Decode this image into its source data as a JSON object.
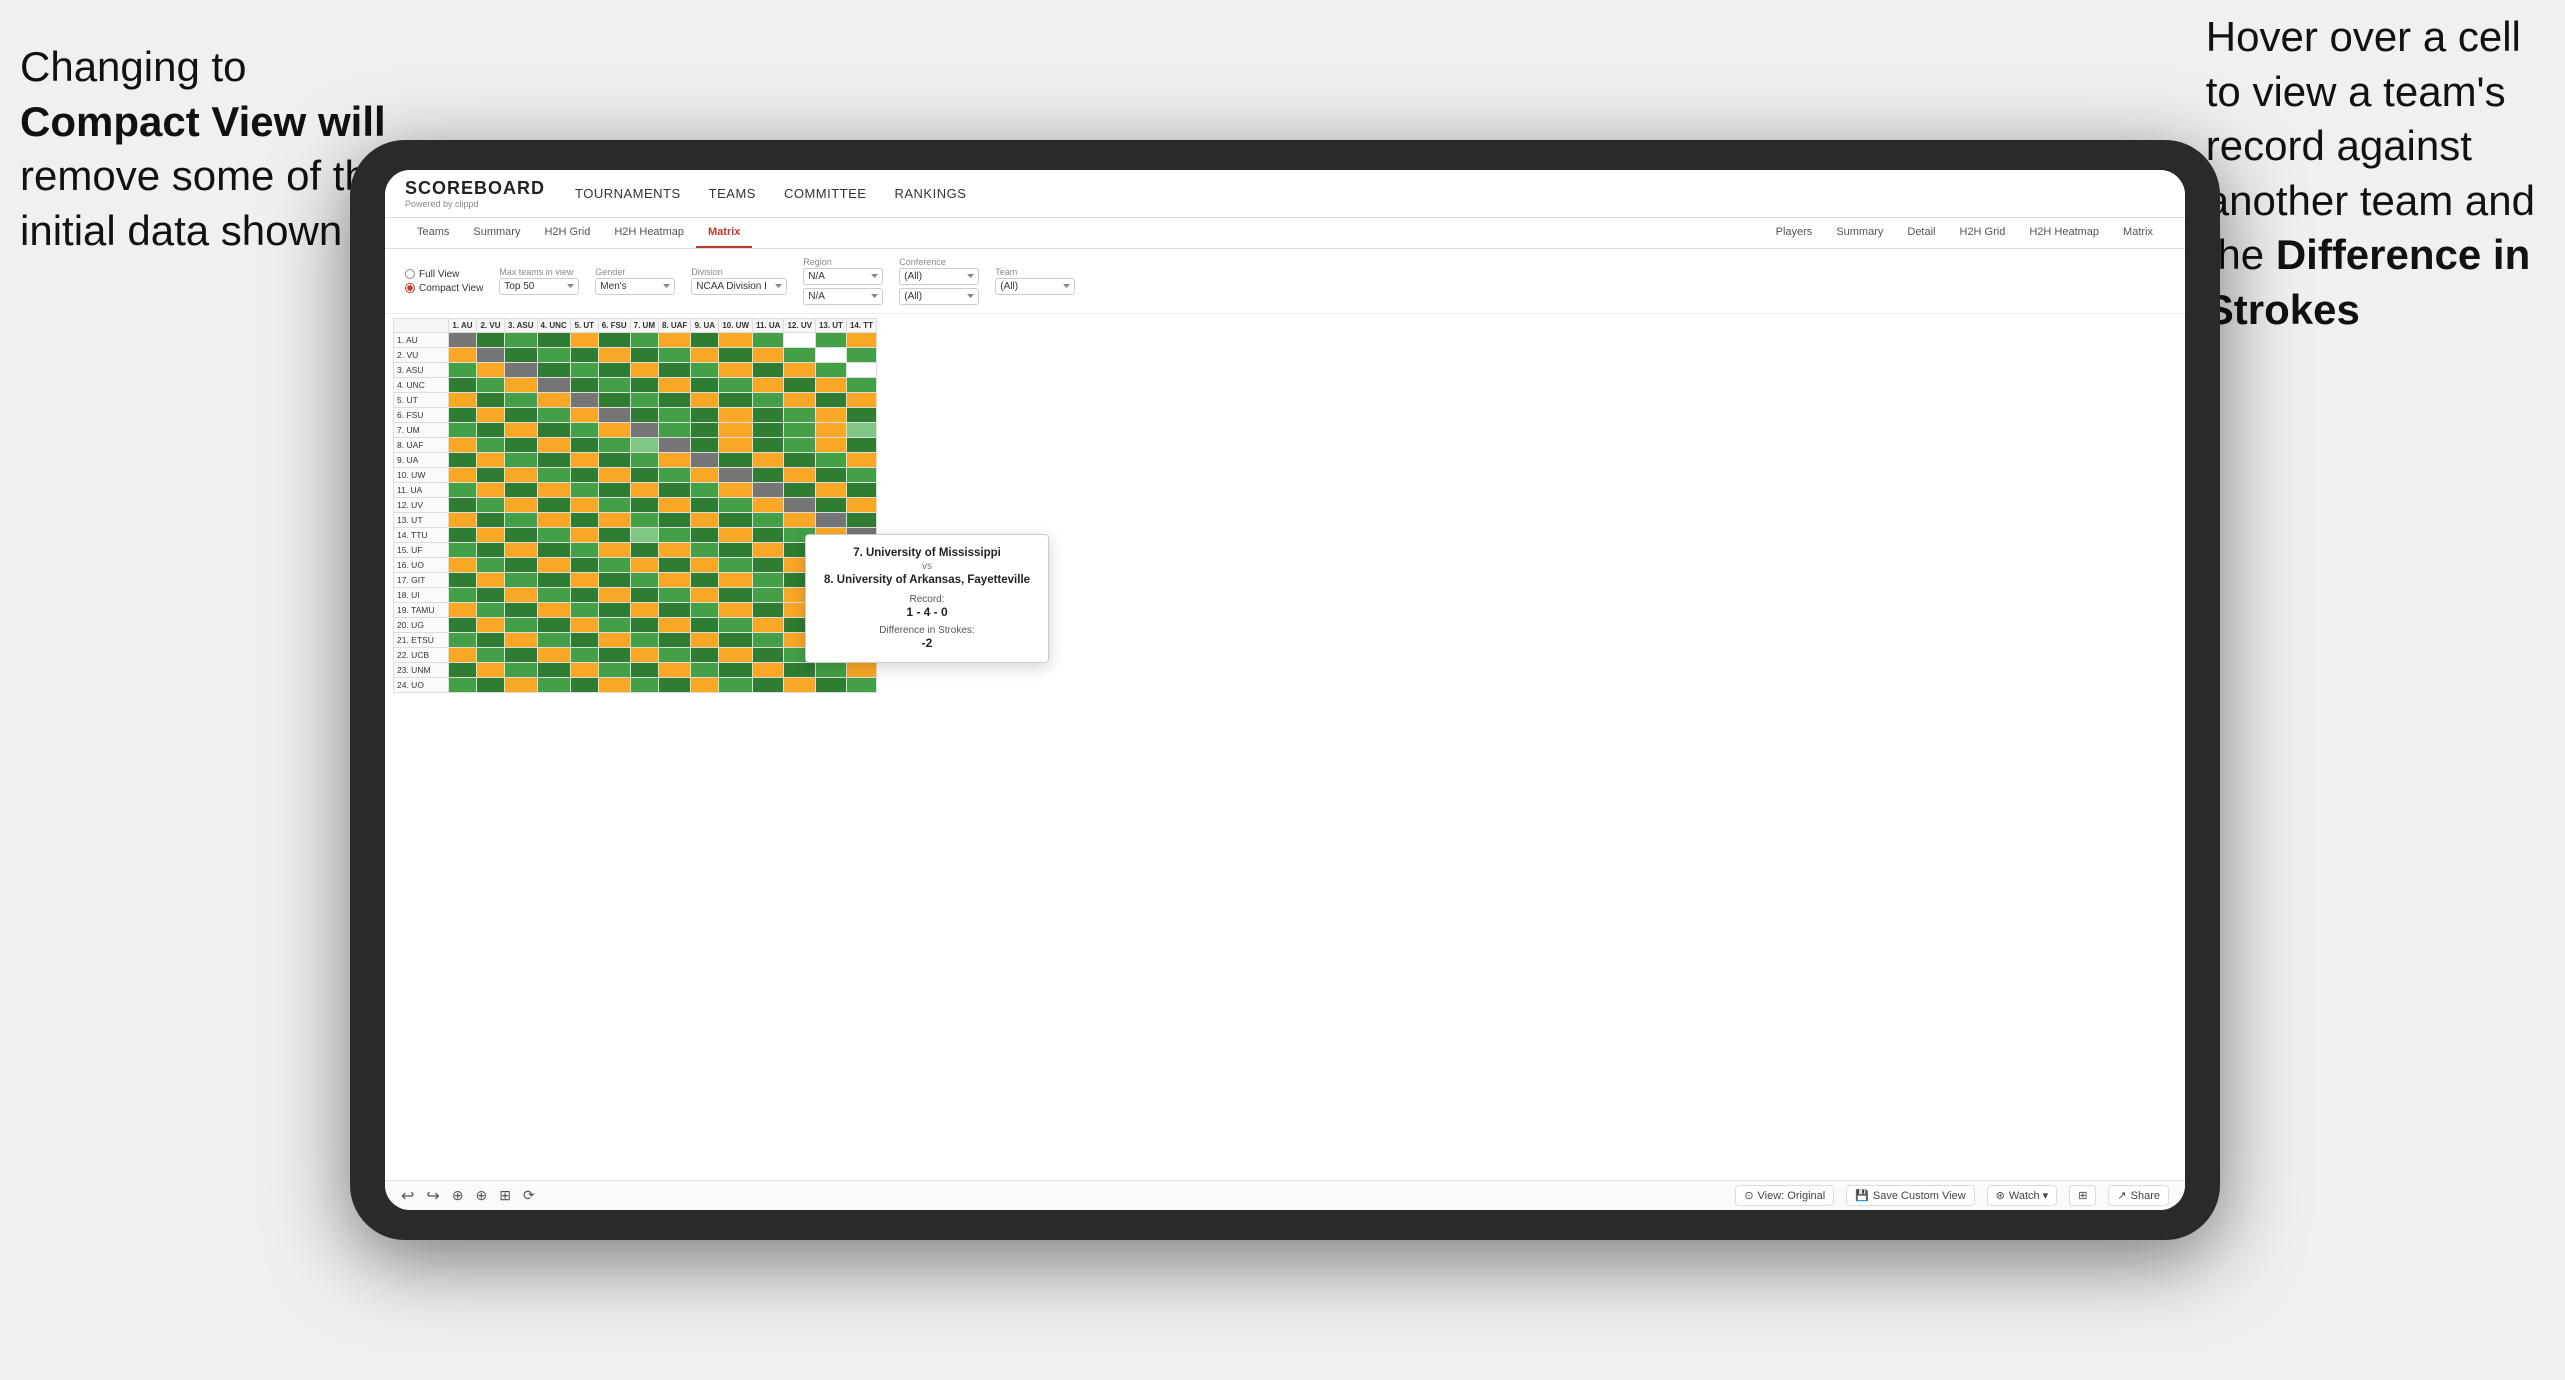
{
  "annotations": {
    "left_text_line1": "Changing to",
    "left_text_line2": "Compact View will",
    "left_text_line3": "remove some of the",
    "left_text_line4": "initial data shown",
    "right_text_line1": "Hover over a cell",
    "right_text_line2": "to view a team's",
    "right_text_line3": "record against",
    "right_text_line4": "another team and",
    "right_text_line5": "the ",
    "right_text_bold": "Difference in",
    "right_text_line6": "Strokes"
  },
  "navbar": {
    "logo": "SCOREBOARD",
    "logo_sub": "Powered by clippd",
    "nav_items": [
      "TOURNAMENTS",
      "TEAMS",
      "COMMITTEE",
      "RANKINGS"
    ]
  },
  "subnav": {
    "left_tabs": [
      "Teams",
      "Summary",
      "H2H Grid",
      "H2H Heatmap",
      "Matrix"
    ],
    "right_tabs": [
      "Players",
      "Summary",
      "Detail",
      "H2H Grid",
      "H2H Heatmap",
      "Matrix"
    ],
    "active": "Matrix"
  },
  "filters": {
    "view_options": [
      "Full View",
      "Compact View"
    ],
    "active_view": "Compact View",
    "max_teams_label": "Max teams in view",
    "max_teams_value": "Top 50",
    "gender_label": "Gender",
    "gender_value": "Men's",
    "division_label": "Division",
    "division_value": "NCAA Division I",
    "region_label": "Region",
    "region_value1": "N/A",
    "region_value2": "N/A",
    "conference_label": "Conference",
    "conference_value1": "(All)",
    "conference_value2": "(All)",
    "team_label": "Team",
    "team_value": "(All)"
  },
  "col_headers": [
    "1. AU",
    "2. VU",
    "3. ASU",
    "4. UNC",
    "5. UT",
    "6. FSU",
    "7. UM",
    "8. UAF",
    "9. UA",
    "10. UW",
    "11. UA",
    "12. UV",
    "13. UT",
    "14. TT"
  ],
  "row_data": [
    {
      "label": "1. AU",
      "cells": [
        "self",
        "g1",
        "g2",
        "g1",
        "y",
        "g1",
        "g2",
        "y",
        "g1",
        "y",
        "g2",
        "w",
        "g2",
        "y"
      ]
    },
    {
      "label": "2. VU",
      "cells": [
        "y",
        "self",
        "g1",
        "g2",
        "g1",
        "y",
        "g1",
        "g2",
        "y",
        "g1",
        "y",
        "g2",
        "w",
        "g2"
      ]
    },
    {
      "label": "3. ASU",
      "cells": [
        "g2",
        "y",
        "self",
        "g1",
        "g2",
        "g1",
        "y",
        "g1",
        "g2",
        "y",
        "g1",
        "y",
        "g2",
        "w"
      ]
    },
    {
      "label": "4. UNC",
      "cells": [
        "g1",
        "g2",
        "y",
        "self",
        "g1",
        "g2",
        "g1",
        "y",
        "g1",
        "g2",
        "y",
        "g1",
        "y",
        "g2"
      ]
    },
    {
      "label": "5. UT",
      "cells": [
        "y",
        "g1",
        "g2",
        "y",
        "self",
        "g1",
        "g2",
        "g1",
        "y",
        "g1",
        "g2",
        "y",
        "g1",
        "y"
      ]
    },
    {
      "label": "6. FSU",
      "cells": [
        "g1",
        "y",
        "g1",
        "g2",
        "y",
        "self",
        "g1",
        "g2",
        "g1",
        "y",
        "g1",
        "g2",
        "y",
        "g1"
      ]
    },
    {
      "label": "7. UM",
      "cells": [
        "g2",
        "g1",
        "y",
        "g1",
        "g2",
        "y",
        "self",
        "g2",
        "g1",
        "y",
        "g1",
        "g2",
        "y",
        "gl"
      ]
    },
    {
      "label": "8. UAF",
      "cells": [
        "y",
        "g2",
        "g1",
        "y",
        "g1",
        "g2",
        "gl",
        "self",
        "g1",
        "y",
        "g1",
        "g2",
        "y",
        "g1"
      ]
    },
    {
      "label": "9. UA",
      "cells": [
        "g1",
        "y",
        "g2",
        "g1",
        "y",
        "g1",
        "g2",
        "y",
        "self",
        "g1",
        "y",
        "g1",
        "g2",
        "y"
      ]
    },
    {
      "label": "10. UW",
      "cells": [
        "y",
        "g1",
        "y",
        "g2",
        "g1",
        "y",
        "g1",
        "g2",
        "y",
        "self",
        "g1",
        "y",
        "g1",
        "g2"
      ]
    },
    {
      "label": "11. UA",
      "cells": [
        "g2",
        "y",
        "g1",
        "y",
        "g2",
        "g1",
        "y",
        "g1",
        "g2",
        "y",
        "self",
        "g1",
        "y",
        "g1"
      ]
    },
    {
      "label": "12. UV",
      "cells": [
        "g1",
        "g2",
        "y",
        "g1",
        "y",
        "g2",
        "g1",
        "y",
        "g1",
        "g2",
        "y",
        "self",
        "g1",
        "y"
      ]
    },
    {
      "label": "13. UT",
      "cells": [
        "y",
        "g1",
        "g2",
        "y",
        "g1",
        "y",
        "g2",
        "g1",
        "y",
        "g1",
        "g2",
        "y",
        "self",
        "g1"
      ]
    },
    {
      "label": "14. TTU",
      "cells": [
        "g1",
        "y",
        "g1",
        "g2",
        "y",
        "g1",
        "gl",
        "g2",
        "g1",
        "y",
        "g1",
        "g2",
        "y",
        "self"
      ]
    },
    {
      "label": "15. UF",
      "cells": [
        "g2",
        "g1",
        "y",
        "g1",
        "g2",
        "y",
        "g1",
        "y",
        "g2",
        "g1",
        "y",
        "g1",
        "g2",
        "y"
      ]
    },
    {
      "label": "16. UO",
      "cells": [
        "y",
        "g2",
        "g1",
        "y",
        "g1",
        "g2",
        "y",
        "g1",
        "y",
        "g2",
        "g1",
        "y",
        "g1",
        "g2"
      ]
    },
    {
      "label": "17. GIT",
      "cells": [
        "g1",
        "y",
        "g2",
        "g1",
        "y",
        "g1",
        "g2",
        "y",
        "g1",
        "y",
        "g2",
        "g1",
        "y",
        "g1"
      ]
    },
    {
      "label": "18. UI",
      "cells": [
        "g2",
        "g1",
        "y",
        "g2",
        "g1",
        "y",
        "g1",
        "g2",
        "y",
        "g1",
        "g2",
        "y",
        "g1",
        "y"
      ]
    },
    {
      "label": "19. TAMU",
      "cells": [
        "y",
        "g2",
        "g1",
        "y",
        "g2",
        "g1",
        "y",
        "g1",
        "g2",
        "y",
        "g1",
        "y",
        "g2",
        "g1"
      ]
    },
    {
      "label": "20. UG",
      "cells": [
        "g1",
        "y",
        "g2",
        "g1",
        "y",
        "g2",
        "g1",
        "y",
        "g1",
        "g2",
        "y",
        "g1",
        "y",
        "g2"
      ]
    },
    {
      "label": "21. ETSU",
      "cells": [
        "g2",
        "g1",
        "y",
        "g2",
        "g1",
        "y",
        "g2",
        "g1",
        "y",
        "g1",
        "g2",
        "y",
        "g1",
        "y"
      ]
    },
    {
      "label": "22. UCB",
      "cells": [
        "y",
        "g2",
        "g1",
        "y",
        "g2",
        "g1",
        "y",
        "g2",
        "g1",
        "y",
        "g1",
        "g2",
        "y",
        "g1"
      ]
    },
    {
      "label": "23. UNM",
      "cells": [
        "g1",
        "y",
        "g2",
        "g1",
        "y",
        "g2",
        "g1",
        "y",
        "g2",
        "g1",
        "y",
        "g1",
        "g2",
        "y"
      ]
    },
    {
      "label": "24. UO",
      "cells": [
        "g2",
        "g1",
        "y",
        "g2",
        "g1",
        "y",
        "g2",
        "g1",
        "y",
        "g2",
        "g1",
        "y",
        "g1",
        "g2"
      ]
    }
  ],
  "tooltip": {
    "team1": "7. University of Mississippi",
    "vs": "vs",
    "team2": "8. University of Arkansas, Fayetteville",
    "record_label": "Record:",
    "record_value": "1 - 4 - 0",
    "strokes_label": "Difference in Strokes:",
    "strokes_value": "-2"
  },
  "toolbar": {
    "undo_label": "↩",
    "redo_label": "↪",
    "view_label": "⊙ View: Original",
    "save_label": "💾 Save Custom View",
    "watch_label": "⊛ Watch ▾",
    "share_label": "↗ Share"
  }
}
